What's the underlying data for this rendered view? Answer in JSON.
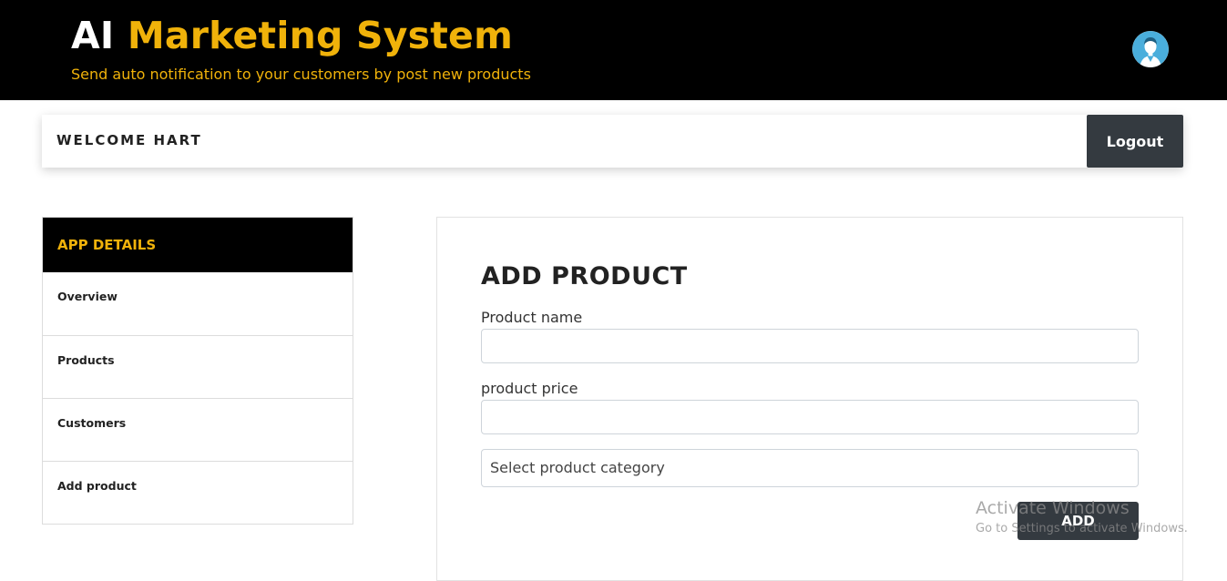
{
  "header": {
    "title_part1": "AI",
    "title_part2": "Marketing System",
    "tagline": "Send auto notification to your customers by post new products",
    "avatar_icon": "user-avatar-icon"
  },
  "welcome_bar": {
    "greeting": "WELCOME HART",
    "logout_label": "Logout"
  },
  "sidebar": {
    "header": "APP DETAILS",
    "items": [
      {
        "label": "Overview"
      },
      {
        "label": "Products"
      },
      {
        "label": "Customers"
      },
      {
        "label": "Add product"
      }
    ]
  },
  "form": {
    "title": "ADD PRODUCT",
    "product_name_label": "Product name",
    "product_name_value": "",
    "product_price_label": "product price",
    "product_price_value": "",
    "category_selected": "Select product category",
    "add_label": "ADD"
  },
  "watermark": {
    "line1": "Activate Windows",
    "line2": "Go to Settings to activate Windows."
  },
  "colors": {
    "topbar": "#000000",
    "accent": "#f0b20a",
    "button": "#343a40"
  }
}
